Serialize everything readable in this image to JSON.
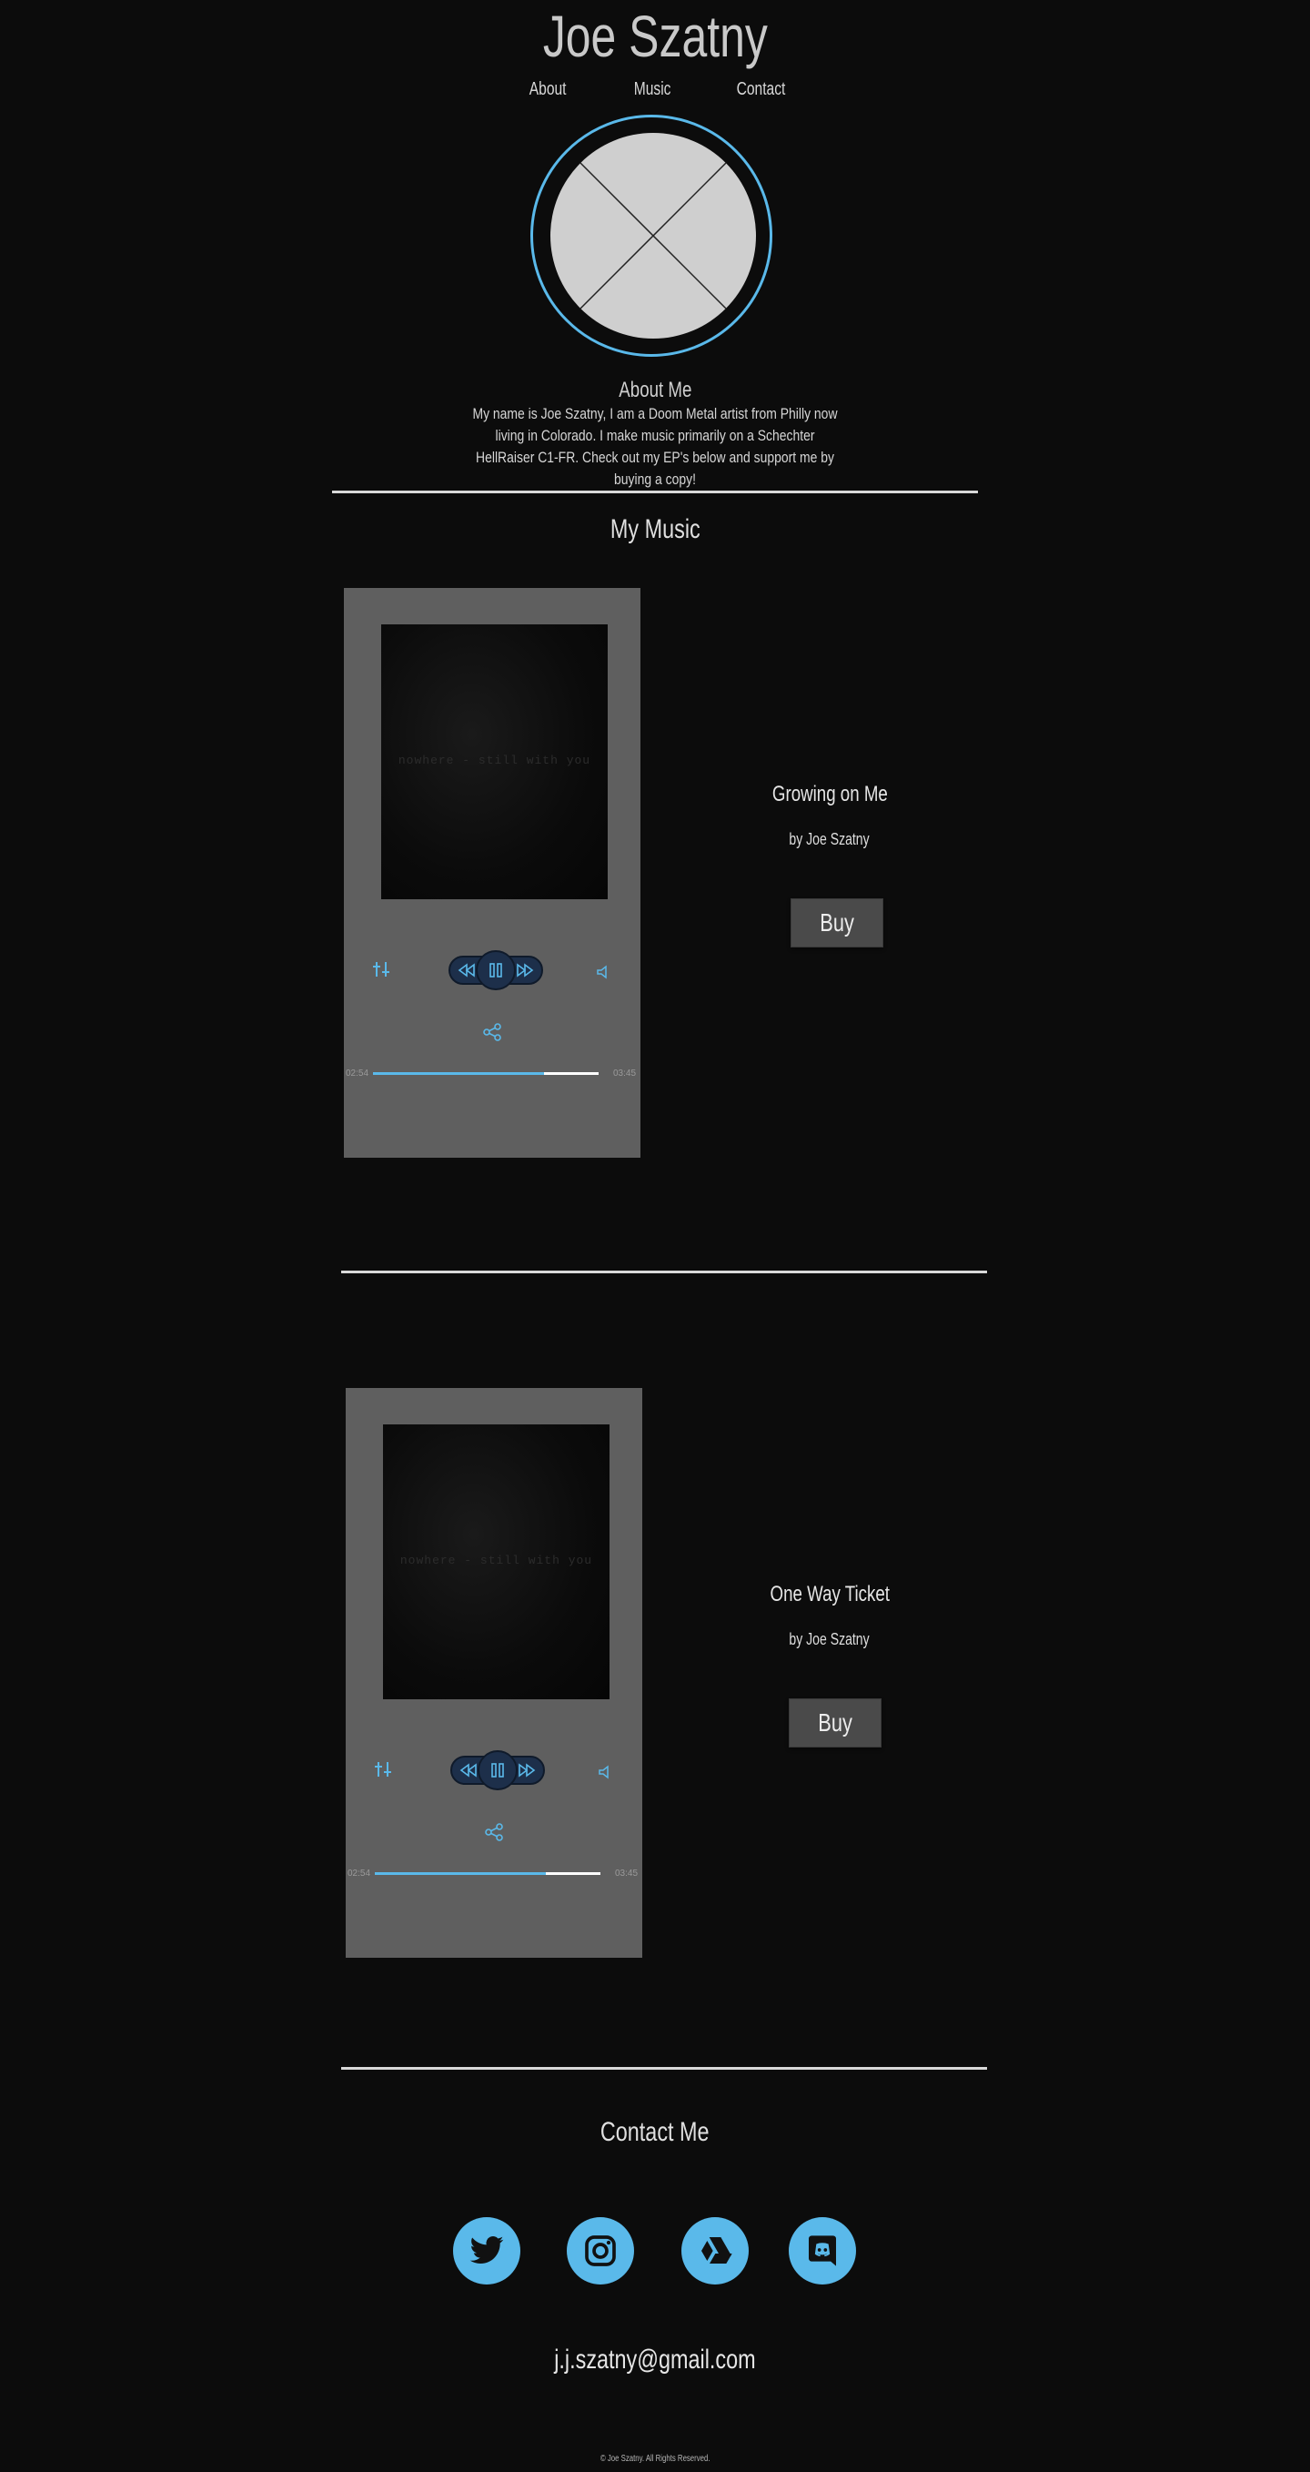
{
  "site": {
    "title": "Joe Szatny"
  },
  "nav": {
    "items": [
      {
        "label": "About"
      },
      {
        "label": "Music"
      },
      {
        "label": "Contact"
      }
    ]
  },
  "about": {
    "heading": "About Me",
    "text": "My name is Joe Szatny, I am a Doom Metal artist from Philly now living in Colorado. I make music primarily on a Schechter HellRaiser C1-FR. Check out my EP's below and support me by buying a copy!"
  },
  "music": {
    "heading": "My Music",
    "songs": [
      {
        "title": "Growing on Me",
        "artist": "by Joe Szatny",
        "buy_label": "Buy",
        "art_text": "nowhere - still with you",
        "time_current": "02:54",
        "time_total": "03:45",
        "progress": 0.76
      },
      {
        "title": "One Way Ticket",
        "artist": "by Joe Szatny",
        "buy_label": "Buy",
        "art_text": "nowhere - still with you",
        "time_current": "02:54",
        "time_total": "03:45",
        "progress": 0.76
      }
    ]
  },
  "contact": {
    "heading": "Contact Me",
    "socials": [
      {
        "icon": "twitter-icon"
      },
      {
        "icon": "instagram-icon"
      },
      {
        "icon": "google-drive-icon"
      },
      {
        "icon": "discord-icon"
      }
    ],
    "email": "j.j.szatny@gmail.com"
  },
  "footer": {
    "text": "© Joe Szatny. All Rights Reserved."
  },
  "colors": {
    "background": "#0c0c0c",
    "accent": "#5ab9ea",
    "player": "#5f5f5f"
  }
}
